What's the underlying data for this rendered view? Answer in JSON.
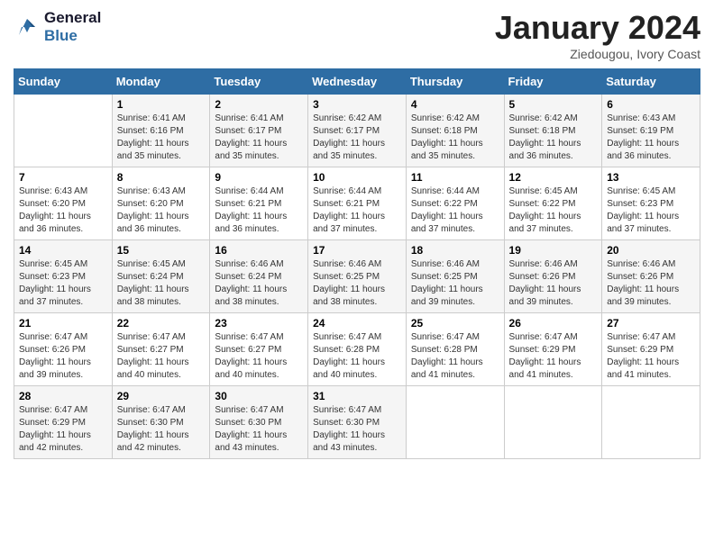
{
  "header": {
    "logo_line1": "General",
    "logo_line2": "Blue",
    "month": "January 2024",
    "location": "Ziedougou, Ivory Coast"
  },
  "weekdays": [
    "Sunday",
    "Monday",
    "Tuesday",
    "Wednesday",
    "Thursday",
    "Friday",
    "Saturday"
  ],
  "weeks": [
    [
      {
        "day": "",
        "sunrise": "",
        "sunset": "",
        "daylight": ""
      },
      {
        "day": "1",
        "sunrise": "Sunrise: 6:41 AM",
        "sunset": "Sunset: 6:16 PM",
        "daylight": "Daylight: 11 hours and 35 minutes."
      },
      {
        "day": "2",
        "sunrise": "Sunrise: 6:41 AM",
        "sunset": "Sunset: 6:17 PM",
        "daylight": "Daylight: 11 hours and 35 minutes."
      },
      {
        "day": "3",
        "sunrise": "Sunrise: 6:42 AM",
        "sunset": "Sunset: 6:17 PM",
        "daylight": "Daylight: 11 hours and 35 minutes."
      },
      {
        "day": "4",
        "sunrise": "Sunrise: 6:42 AM",
        "sunset": "Sunset: 6:18 PM",
        "daylight": "Daylight: 11 hours and 35 minutes."
      },
      {
        "day": "5",
        "sunrise": "Sunrise: 6:42 AM",
        "sunset": "Sunset: 6:18 PM",
        "daylight": "Daylight: 11 hours and 36 minutes."
      },
      {
        "day": "6",
        "sunrise": "Sunrise: 6:43 AM",
        "sunset": "Sunset: 6:19 PM",
        "daylight": "Daylight: 11 hours and 36 minutes."
      }
    ],
    [
      {
        "day": "7",
        "sunrise": "Sunrise: 6:43 AM",
        "sunset": "Sunset: 6:20 PM",
        "daylight": "Daylight: 11 hours and 36 minutes."
      },
      {
        "day": "8",
        "sunrise": "Sunrise: 6:43 AM",
        "sunset": "Sunset: 6:20 PM",
        "daylight": "Daylight: 11 hours and 36 minutes."
      },
      {
        "day": "9",
        "sunrise": "Sunrise: 6:44 AM",
        "sunset": "Sunset: 6:21 PM",
        "daylight": "Daylight: 11 hours and 36 minutes."
      },
      {
        "day": "10",
        "sunrise": "Sunrise: 6:44 AM",
        "sunset": "Sunset: 6:21 PM",
        "daylight": "Daylight: 11 hours and 37 minutes."
      },
      {
        "day": "11",
        "sunrise": "Sunrise: 6:44 AM",
        "sunset": "Sunset: 6:22 PM",
        "daylight": "Daylight: 11 hours and 37 minutes."
      },
      {
        "day": "12",
        "sunrise": "Sunrise: 6:45 AM",
        "sunset": "Sunset: 6:22 PM",
        "daylight": "Daylight: 11 hours and 37 minutes."
      },
      {
        "day": "13",
        "sunrise": "Sunrise: 6:45 AM",
        "sunset": "Sunset: 6:23 PM",
        "daylight": "Daylight: 11 hours and 37 minutes."
      }
    ],
    [
      {
        "day": "14",
        "sunrise": "Sunrise: 6:45 AM",
        "sunset": "Sunset: 6:23 PM",
        "daylight": "Daylight: 11 hours and 37 minutes."
      },
      {
        "day": "15",
        "sunrise": "Sunrise: 6:45 AM",
        "sunset": "Sunset: 6:24 PM",
        "daylight": "Daylight: 11 hours and 38 minutes."
      },
      {
        "day": "16",
        "sunrise": "Sunrise: 6:46 AM",
        "sunset": "Sunset: 6:24 PM",
        "daylight": "Daylight: 11 hours and 38 minutes."
      },
      {
        "day": "17",
        "sunrise": "Sunrise: 6:46 AM",
        "sunset": "Sunset: 6:25 PM",
        "daylight": "Daylight: 11 hours and 38 minutes."
      },
      {
        "day": "18",
        "sunrise": "Sunrise: 6:46 AM",
        "sunset": "Sunset: 6:25 PM",
        "daylight": "Daylight: 11 hours and 39 minutes."
      },
      {
        "day": "19",
        "sunrise": "Sunrise: 6:46 AM",
        "sunset": "Sunset: 6:26 PM",
        "daylight": "Daylight: 11 hours and 39 minutes."
      },
      {
        "day": "20",
        "sunrise": "Sunrise: 6:46 AM",
        "sunset": "Sunset: 6:26 PM",
        "daylight": "Daylight: 11 hours and 39 minutes."
      }
    ],
    [
      {
        "day": "21",
        "sunrise": "Sunrise: 6:47 AM",
        "sunset": "Sunset: 6:26 PM",
        "daylight": "Daylight: 11 hours and 39 minutes."
      },
      {
        "day": "22",
        "sunrise": "Sunrise: 6:47 AM",
        "sunset": "Sunset: 6:27 PM",
        "daylight": "Daylight: 11 hours and 40 minutes."
      },
      {
        "day": "23",
        "sunrise": "Sunrise: 6:47 AM",
        "sunset": "Sunset: 6:27 PM",
        "daylight": "Daylight: 11 hours and 40 minutes."
      },
      {
        "day": "24",
        "sunrise": "Sunrise: 6:47 AM",
        "sunset": "Sunset: 6:28 PM",
        "daylight": "Daylight: 11 hours and 40 minutes."
      },
      {
        "day": "25",
        "sunrise": "Sunrise: 6:47 AM",
        "sunset": "Sunset: 6:28 PM",
        "daylight": "Daylight: 11 hours and 41 minutes."
      },
      {
        "day": "26",
        "sunrise": "Sunrise: 6:47 AM",
        "sunset": "Sunset: 6:29 PM",
        "daylight": "Daylight: 11 hours and 41 minutes."
      },
      {
        "day": "27",
        "sunrise": "Sunrise: 6:47 AM",
        "sunset": "Sunset: 6:29 PM",
        "daylight": "Daylight: 11 hours and 41 minutes."
      }
    ],
    [
      {
        "day": "28",
        "sunrise": "Sunrise: 6:47 AM",
        "sunset": "Sunset: 6:29 PM",
        "daylight": "Daylight: 11 hours and 42 minutes."
      },
      {
        "day": "29",
        "sunrise": "Sunrise: 6:47 AM",
        "sunset": "Sunset: 6:30 PM",
        "daylight": "Daylight: 11 hours and 42 minutes."
      },
      {
        "day": "30",
        "sunrise": "Sunrise: 6:47 AM",
        "sunset": "Sunset: 6:30 PM",
        "daylight": "Daylight: 11 hours and 43 minutes."
      },
      {
        "day": "31",
        "sunrise": "Sunrise: 6:47 AM",
        "sunset": "Sunset: 6:30 PM",
        "daylight": "Daylight: 11 hours and 43 minutes."
      },
      {
        "day": "",
        "sunrise": "",
        "sunset": "",
        "daylight": ""
      },
      {
        "day": "",
        "sunrise": "",
        "sunset": "",
        "daylight": ""
      },
      {
        "day": "",
        "sunrise": "",
        "sunset": "",
        "daylight": ""
      }
    ]
  ]
}
